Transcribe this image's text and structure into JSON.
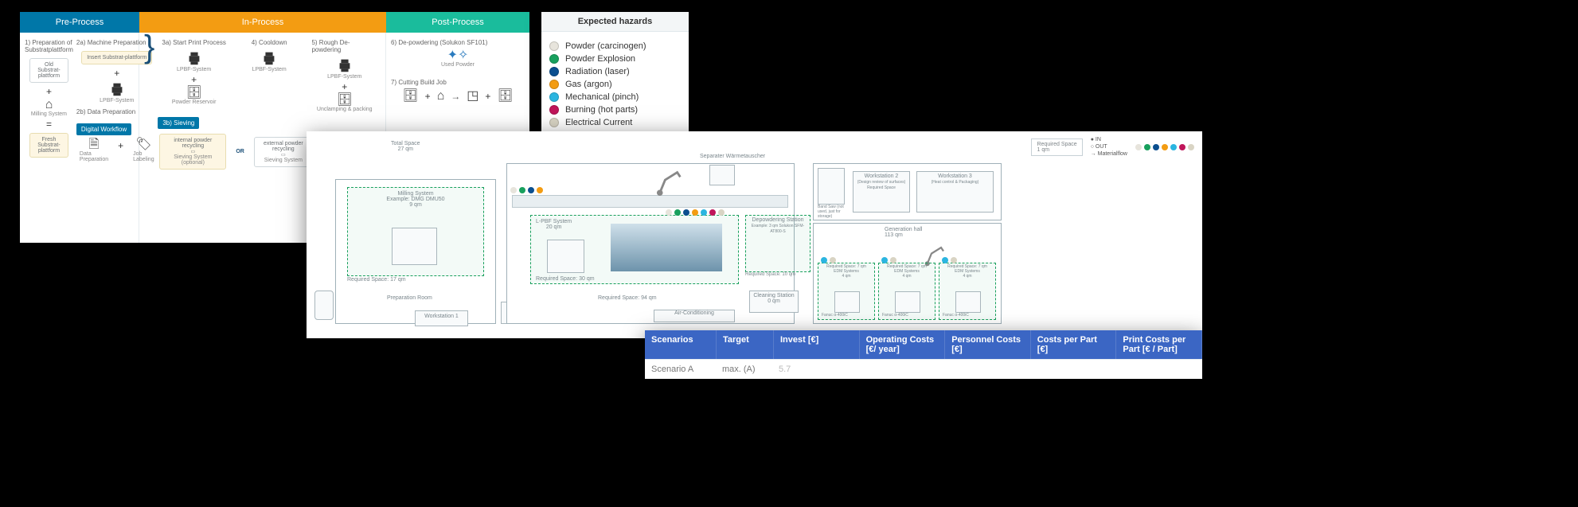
{
  "process": {
    "phases": {
      "pre": "Pre-Process",
      "in": "In-Process",
      "post": "Post-Process"
    },
    "steps": {
      "s1": "1)  Preparation of Substratplattform",
      "s2a": "2a)  Machine Preparation",
      "s2b": "2b)  Data Preparation",
      "s3a": "3a) Start Print Process",
      "s3b": "3b) Sieving",
      "s4": "4)  Cooldown",
      "s5": "5)  Rough De-powdering",
      "s6": "6)  De-powdering (Solukon SF101)",
      "s7": "7)  Cutting Build Job"
    },
    "boxes": {
      "old_sub": "Old Substrat-plattform",
      "insert_sub": "Insert Substrat-plattform",
      "fresh_sub": "Fresh Substrat-plattform",
      "lpbf": "LPBF-System",
      "powder_res": "Powder Reservoir",
      "dataprep": "Data Preparation",
      "joblabel": "Job Labeling",
      "digworkflow": "Digital Workflow",
      "sieving_int": "internal powder recycling",
      "sieving_ext": "external powder recycling",
      "sieving_sys": "Sieving System",
      "optional": "(optional)",
      "or": "OR",
      "unclamp": "Unclamping & packing",
      "used_powder": "Used Powder",
      "milling": "Milling System",
      "equals": "="
    }
  },
  "hazards": {
    "title": "Expected hazards",
    "items": [
      {
        "label": "Powder (carcinogen)",
        "color": "#e7e4dc"
      },
      {
        "label": "Powder Explosion",
        "color": "#18a05d"
      },
      {
        "label": "Radiation (laser)",
        "color": "#0b4f8f"
      },
      {
        "label": "Gas (argon)",
        "color": "#f39c12"
      },
      {
        "label": "Mechanical (pinch)",
        "color": "#2bb5e0"
      },
      {
        "label": "Burning (hot parts)",
        "color": "#c0155a"
      },
      {
        "label": "Electrical Current",
        "color": "#d9d4c4"
      }
    ]
  },
  "floorplan": {
    "legendbox": {
      "line1": "Required Space",
      "line2": "1 qm"
    },
    "legendkey": {
      "in": "IN",
      "out": "OUT",
      "flow": "Materialflow"
    },
    "totalspace": {
      "label": "Total Space",
      "val": "27 qm"
    },
    "milling": {
      "title": "Milling System",
      "sub": "Example: DMG DMU50",
      "area": "9 qm"
    },
    "prep_req": "Required Space: 17 qm",
    "preproom": "Preparation Room",
    "ws1": "Workstation 1",
    "lpbf": {
      "title": "L-PBF System",
      "area": "20 qm",
      "req": "Required Space: 30 qm"
    },
    "mainreq": "Required Space: 94 qm",
    "sep": "Separater Wärmetauscher",
    "depowder": {
      "title": "Depowdering Station",
      "sub": "Example: 3 qm Solukon SFM-AT800-S",
      "req": "Required Space: 10 qm"
    },
    "clean": {
      "title": "Cleaning Station",
      "area": "0 qm"
    },
    "aircon": "Air-Conditioning",
    "ws2": {
      "title": "Workstation 2",
      "sub": "(Design review of surfaces)",
      "req": "Required Space"
    },
    "ws3": {
      "title": "Workstation 3",
      "sub": "(Heat control & Packaging)"
    },
    "genhall": {
      "title": "Generation hall",
      "area": "113 qm"
    },
    "edm": {
      "title": "EDM Systems",
      "area": "4 qm",
      "req": "Required Space: 7 qm",
      "model": "Fanuc α-400iC"
    },
    "misc": {
      "bandsaw": "Band Saw (not used, just for storage)"
    }
  },
  "cost_table": {
    "headers": {
      "scenarios": "Scenarios",
      "target": "Target",
      "invest": "Invest [€]",
      "operating": "Operating Costs [€/ year]",
      "personnel": "Personnel Costs [€]",
      "cpp": "Costs per Part [€]",
      "printcpp": "Print Costs per Part [€ / Part]"
    },
    "rows": [
      {
        "scenario": "Scenario A",
        "target": "max. (A)",
        "invest": "5.7"
      }
    ]
  },
  "colors": {
    "hdr_blue": "#3b66c4"
  }
}
